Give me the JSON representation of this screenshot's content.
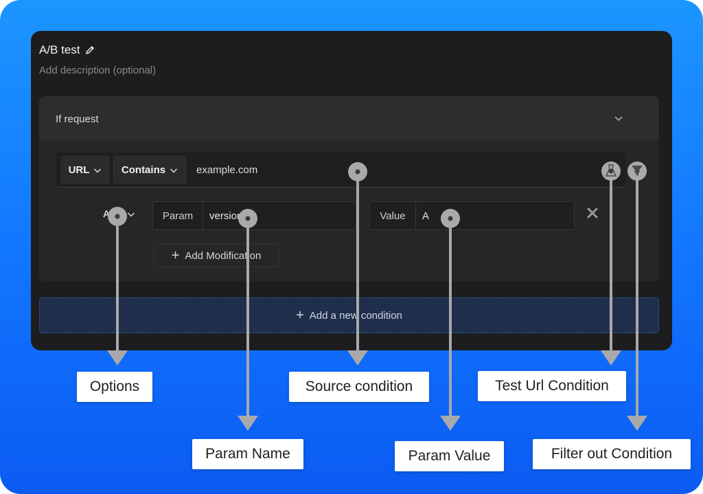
{
  "card": {
    "title": "A/B test",
    "description": "Add description (optional)"
  },
  "section": {
    "title": "If request"
  },
  "url_row": {
    "source": "URL",
    "operator": "Contains",
    "value": "example.com"
  },
  "modification": {
    "action": "ADD",
    "param_label": "Param",
    "param_value": "version",
    "value_label": "Value",
    "value_value": "A"
  },
  "buttons": {
    "add_modification": "Add Modification",
    "add_condition": "Add a new condition"
  },
  "annotations": {
    "options": "Options",
    "param_name": "Param Name",
    "source_condition": "Source condition",
    "param_value": "Param Value",
    "test_url_condition": "Test Url Condition",
    "filter_out_condition": "Filter out Condition"
  },
  "colors": {
    "background": "#1277ff",
    "card": "#1d1d1f",
    "add_condition_bg": "#1f2e4a"
  },
  "icons": [
    "pencil-icon",
    "chevron-down-icon",
    "test-flask-icon",
    "filter-icon",
    "close-icon",
    "plus-icon"
  ]
}
